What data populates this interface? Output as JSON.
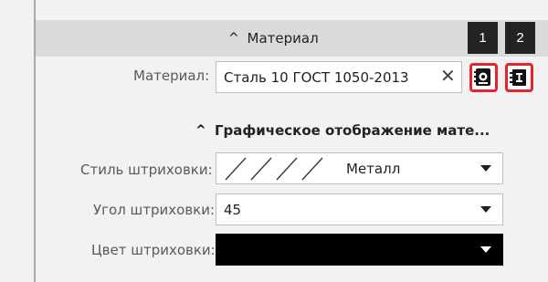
{
  "material_section": {
    "title": "Материал",
    "badges": [
      "1",
      "2"
    ],
    "material_label": "Материал:",
    "material_value": "Сталь 10  ГОСТ 1050-2013"
  },
  "hatch_section": {
    "title": "Графическое отображение мате...",
    "style_label": "Стиль штриховки:",
    "style_value": "Металл",
    "angle_label": "Угол штриховки:",
    "angle_value": "45",
    "color_label": "Цвет штриховки:",
    "color_value_hex": "#000000"
  },
  "colors": {
    "header_bg": "#dadada",
    "highlight": "#e5252b",
    "badge_bg": "#232323"
  },
  "icons": {
    "collapse": "chevron-up-icon",
    "clear": "close-icon",
    "library": "material-library-icon",
    "select": "material-select-icon",
    "dropdown": "chevron-down-icon"
  }
}
